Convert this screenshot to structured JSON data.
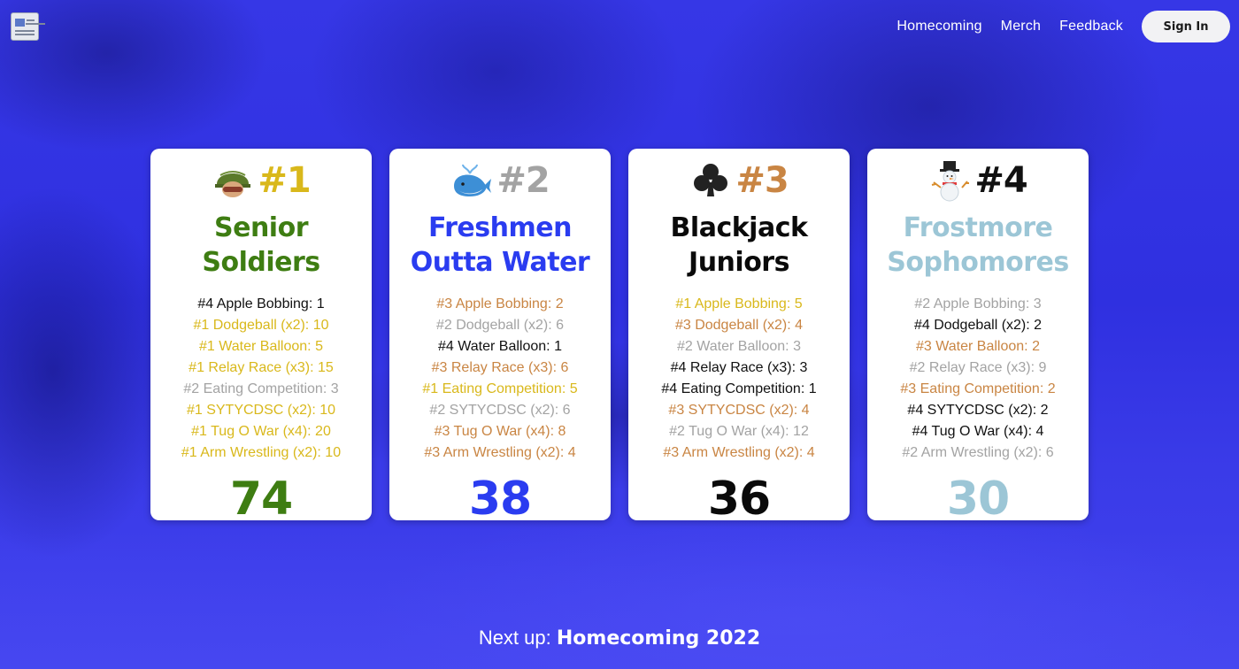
{
  "nav": {
    "links": [
      "Homecoming",
      "Merch",
      "Feedback"
    ],
    "signin_label": "Sign In"
  },
  "teams": [
    {
      "rank": "#1",
      "name_line1": "Senior",
      "name_line2": "Soldiers",
      "emoji": "military-helmet-icon",
      "rank_color": "#d9b81b",
      "team_color": "#3e7d12",
      "events": [
        {
          "text": "#4 Apple Bobbing: 1",
          "place": 4
        },
        {
          "text": "#1 Dodgeball (x2): 10",
          "place": 1
        },
        {
          "text": "#1 Water Balloon: 5",
          "place": 1
        },
        {
          "text": "#1 Relay Race (x3): 15",
          "place": 1
        },
        {
          "text": "#2 Eating Competition: 3",
          "place": 2
        },
        {
          "text": "#1 SYTYCDSC (x2): 10",
          "place": 1
        },
        {
          "text": "#1 Tug O War (x4): 20",
          "place": 1
        },
        {
          "text": "#1 Arm Wrestling (x2): 10",
          "place": 1
        }
      ],
      "total": "74"
    },
    {
      "rank": "#2",
      "name_line1": "Freshmen",
      "name_line2": "Outta Water",
      "emoji": "whale-icon",
      "rank_color": "#a3a3a3",
      "team_color": "#2a3cf0",
      "events": [
        {
          "text": "#3 Apple Bobbing: 2",
          "place": 3
        },
        {
          "text": "#2 Dodgeball (x2): 6",
          "place": 2
        },
        {
          "text": "#4 Water Balloon: 1",
          "place": 4
        },
        {
          "text": "#3 Relay Race (x3): 6",
          "place": 3
        },
        {
          "text": "#1 Eating Competition: 5",
          "place": 1
        },
        {
          "text": "#2 SYTYCDSC (x2): 6",
          "place": 2
        },
        {
          "text": "#3 Tug O War (x4): 8",
          "place": 3
        },
        {
          "text": "#3 Arm Wrestling (x2): 4",
          "place": 3
        }
      ],
      "total": "38"
    },
    {
      "rank": "#3",
      "name_line1": "Blackjack",
      "name_line2": "Juniors",
      "emoji": "club-suit-icon",
      "rank_color": "#c98543",
      "team_color": "#0a0a0a",
      "events": [
        {
          "text": "#1 Apple Bobbing: 5",
          "place": 1
        },
        {
          "text": "#3 Dodgeball (x2): 4",
          "place": 3
        },
        {
          "text": "#2 Water Balloon: 3",
          "place": 2
        },
        {
          "text": "#4 Relay Race (x3): 3",
          "place": 4
        },
        {
          "text": "#4 Eating Competition: 1",
          "place": 4
        },
        {
          "text": "#3 SYTYCDSC (x2): 4",
          "place": 3
        },
        {
          "text": "#2 Tug O War (x4): 12",
          "place": 2
        },
        {
          "text": "#3 Arm Wrestling (x2): 4",
          "place": 3
        }
      ],
      "total": "36"
    },
    {
      "rank": "#4",
      "name_line1": "Frostmore",
      "name_line2": "Sophomores",
      "emoji": "snowman-icon",
      "rank_color": "#111111",
      "team_color": "#9cc6d6",
      "events": [
        {
          "text": "#2 Apple Bobbing: 3",
          "place": 2
        },
        {
          "text": "#4 Dodgeball (x2): 2",
          "place": 4
        },
        {
          "text": "#3 Water Balloon: 2",
          "place": 3
        },
        {
          "text": "#2 Relay Race (x3): 9",
          "place": 2
        },
        {
          "text": "#3 Eating Competition: 2",
          "place": 3
        },
        {
          "text": "#4 SYTYCDSC (x2): 2",
          "place": 4
        },
        {
          "text": "#4 Tug O War (x4): 4",
          "place": 4
        },
        {
          "text": "#2 Arm Wrestling (x2): 6",
          "place": 2
        }
      ],
      "total": "30"
    }
  ],
  "footer": {
    "prefix": "Next up:",
    "event": "Homecoming 2022"
  }
}
